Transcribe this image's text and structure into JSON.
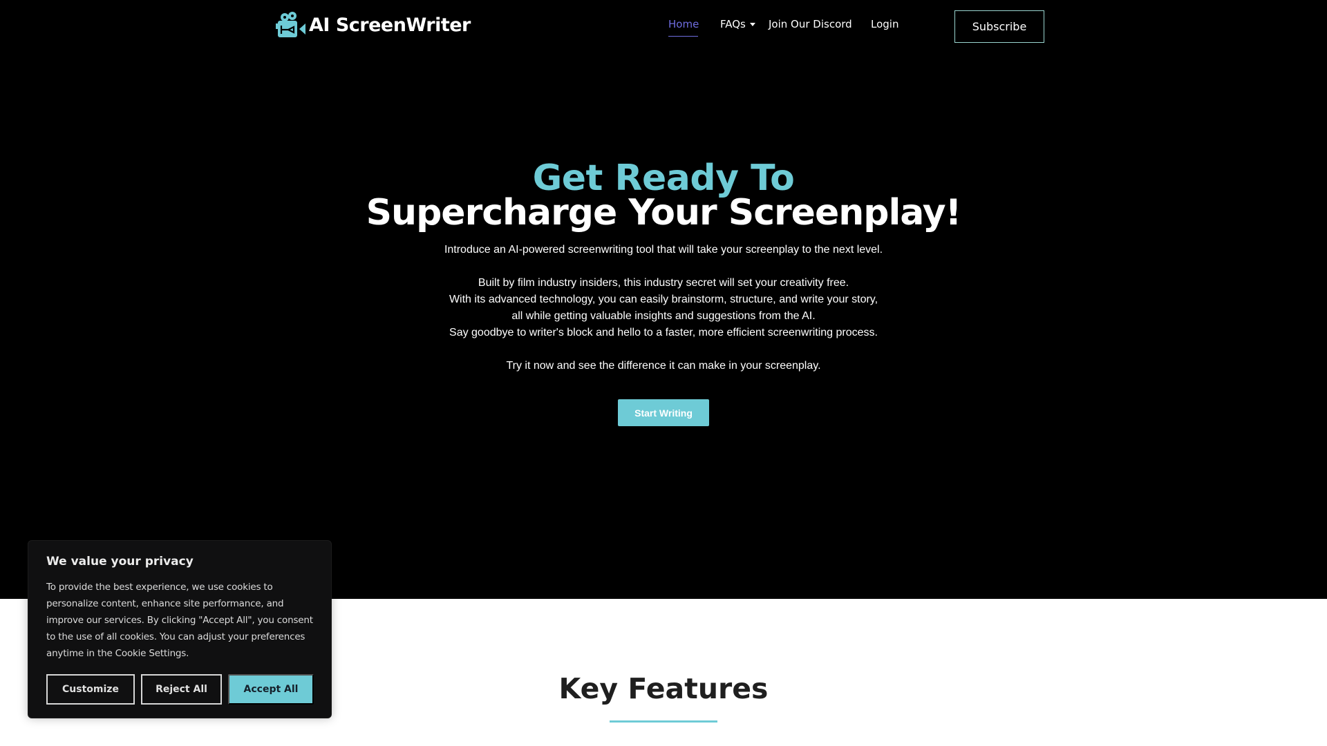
{
  "brand": {
    "name": "AI ScreenWriter",
    "icon": "film-camera-pen-icon",
    "accent_color": "#6ecbd6",
    "active_nav_color": "#6f6de0"
  },
  "nav": {
    "items": [
      {
        "label": "Home",
        "active": true
      },
      {
        "label": "FAQs",
        "has_dropdown": true
      },
      {
        "label": "Join Our Discord"
      },
      {
        "label": "Login"
      }
    ],
    "subscribe_label": "Subscribe"
  },
  "hero": {
    "title_line1": "Get Ready To",
    "title_line2": "Supercharge Your Screenplay!",
    "intro": "Introduce an AI-powered screenwriting tool that will take your screenplay to the next level.",
    "body_lines": [
      "Built by film industry insiders, this industry secret will set your creativity free.",
      "With its advanced technology, you can easily brainstorm, structure, and write your story,",
      "all while getting valuable insights and suggestions from the AI.",
      "Say goodbye to writer's block and hello to a faster, more efficient screenwriting process."
    ],
    "cta_text": "Try it now and see the difference it can make in your screenplay.",
    "cta_button": "Start Writing"
  },
  "features": {
    "title": "Key Features"
  },
  "cookie_banner": {
    "title": "We value your privacy",
    "body": "To provide the best experience, we use cookies to personalize content, enhance site performance, and improve our services. By clicking \"Accept All\", you consent to the use of all cookies. You can adjust your preferences anytime in the Cookie Settings.",
    "customize_label": "Customize",
    "reject_label": "Reject All",
    "accept_label": "Accept All"
  }
}
